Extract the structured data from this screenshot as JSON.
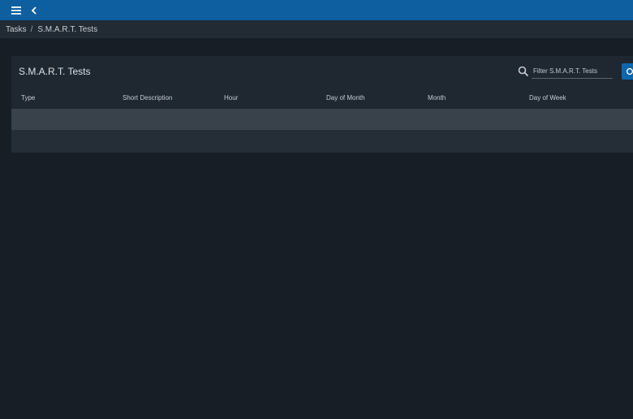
{
  "breadcrumb": {
    "items": [
      "Tasks",
      "S.M.A.R.T. Tests"
    ],
    "separator": "/"
  },
  "card": {
    "title": "S.M.A.R.T. Tests",
    "filter_placeholder": "Filter S.M.A.R.T. Tests"
  },
  "table": {
    "columns": [
      "Type",
      "Short Description",
      "Hour",
      "Day of Month",
      "Month",
      "Day of Week"
    ],
    "rows": []
  },
  "icons": {
    "menu": "menu-icon",
    "back": "chevron-left-icon",
    "search": "search-icon",
    "add": "add-icon"
  },
  "colors": {
    "topbar": "#0d5fa0",
    "background": "#181e26",
    "card": "#1f2730",
    "accent": "#0e67ad"
  }
}
